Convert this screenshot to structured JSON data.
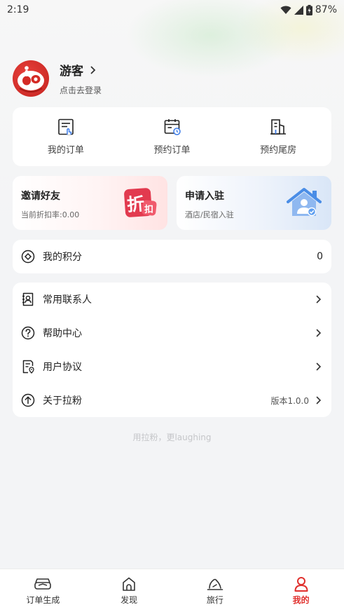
{
  "status_bar": {
    "time": "2:19",
    "battery": "87%"
  },
  "profile": {
    "name": "游客",
    "login_hint": "点击去登录"
  },
  "orders": [
    {
      "label": "我的订单",
      "icon": "order-list-icon"
    },
    {
      "label": "预约订单",
      "icon": "calendar-clock-icon"
    },
    {
      "label": "预约尾房",
      "icon": "building-icon"
    }
  ],
  "promos": {
    "invite": {
      "title": "邀请好友",
      "subtitle": "当前折扣率:0.00",
      "badge_main": "折",
      "badge_sub": "扣"
    },
    "apply": {
      "title": "申请入驻",
      "subtitle": "酒店/民宿入驻"
    }
  },
  "points": {
    "label": "我的积分",
    "value": "0"
  },
  "menu": [
    {
      "label": "常用联系人",
      "icon": "contact-icon"
    },
    {
      "label": "帮助中心",
      "icon": "help-icon"
    },
    {
      "label": "用户协议",
      "icon": "agreement-icon"
    },
    {
      "label": "关于拉粉",
      "icon": "upload-circle-icon",
      "extra": "版本1.0.0"
    }
  ],
  "slogan": "用拉粉，更laughing",
  "tabs": [
    {
      "label": "订单生成",
      "icon": "order-generate-icon",
      "active": false
    },
    {
      "label": "发现",
      "icon": "discover-icon",
      "active": false
    },
    {
      "label": "旅行",
      "icon": "travel-icon",
      "active": false
    },
    {
      "label": "我的",
      "icon": "profile-icon",
      "active": true
    }
  ],
  "colors": {
    "accent": "#e0302d",
    "background": "#f3f4f6",
    "card": "#ffffff"
  }
}
